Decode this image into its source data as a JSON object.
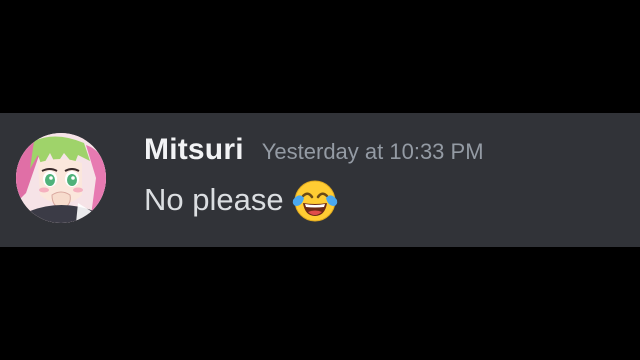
{
  "message": {
    "author": "Mitsuri",
    "timestamp": "Yesterday at 10:33 PM",
    "text": "No please",
    "emoji": "face-with-tears-of-joy-icon"
  },
  "colors": {
    "band_background": "#313338",
    "page_background": "#000000",
    "username": "#f2f3f5",
    "timestamp": "#949ba4",
    "message_text": "#dbdee1"
  }
}
